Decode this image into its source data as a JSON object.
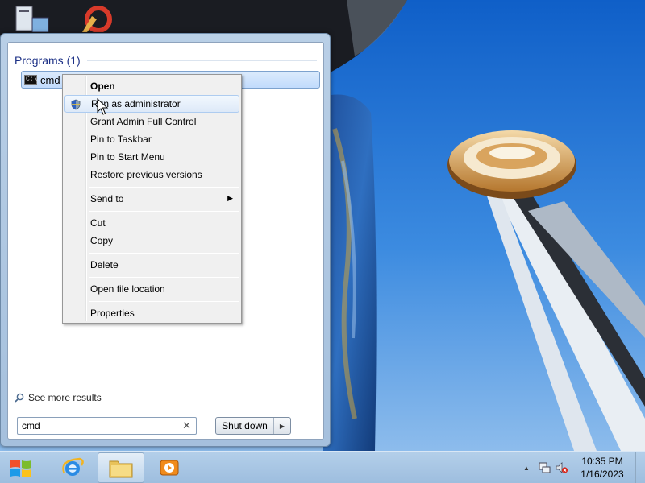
{
  "start_menu": {
    "section_title": "Programs (1)",
    "program": {
      "label": "cmd",
      "icon": "cmd-icon",
      "icon_text": "C:\\"
    },
    "see_more": "See more results",
    "search": {
      "value": "cmd",
      "clear_glyph": "✕"
    },
    "shutdown": {
      "label": "Shut down",
      "arrow": "▶"
    }
  },
  "context_menu": {
    "items": [
      {
        "label": "Open",
        "bold": true
      },
      {
        "label": "Run as administrator",
        "icon": "uac-shield-icon",
        "hovered": true
      },
      {
        "label": "Grant Admin Full Control"
      },
      {
        "label": "Pin to Taskbar"
      },
      {
        "label": "Pin to Start Menu"
      },
      {
        "label": "Restore previous versions"
      },
      {
        "label": "Send to",
        "submenu": true
      },
      {
        "label": "Cut"
      },
      {
        "label": "Copy"
      },
      {
        "label": "Delete"
      },
      {
        "label": "Open file location"
      },
      {
        "label": "Properties"
      }
    ],
    "submenu_glyph": "▶"
  },
  "taskbar": {
    "start_icon": "windows-logo-icon",
    "pinned": [
      {
        "name": "internet-explorer-icon",
        "active": false
      },
      {
        "name": "file-explorer-icon",
        "active": true
      },
      {
        "name": "media-player-icon",
        "active": false
      }
    ],
    "tray": {
      "show_hidden_glyph": "▲",
      "icons": [
        "network-icon",
        "volume-muted-icon"
      ],
      "time": "10:35 PM",
      "date": "1/16/2023"
    }
  },
  "colors": {
    "menu_section_title": "#1e3287",
    "sky_top": "#0f5fc8",
    "sky_bottom": "#7fb2ea",
    "taskbar": "#a3c1df"
  }
}
